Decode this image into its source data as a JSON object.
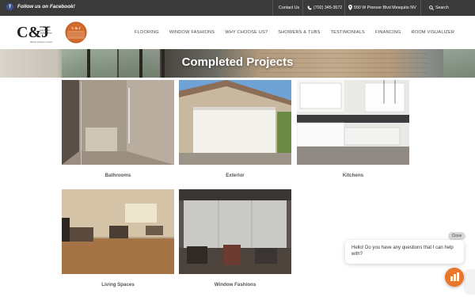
{
  "topbar": {
    "facebook_label": "Follow us on Facebook!",
    "contact_label": "Contact Us",
    "phone": "(702) 345-3672",
    "address": "550 W Pioneer Blvd Mesquite NV",
    "search_label": "Search"
  },
  "brand": {
    "logo_initials": "C&J",
    "owners_title": "OWNERS",
    "owner_1": "Cole Barton",
    "owner_2": "Jackie Barton",
    "tagline": "Home Design Center",
    "badge_text": "C & J"
  },
  "nav": {
    "items": [
      "FLOORING",
      "WINDOW FASHIONS",
      "WHY CHOOSE US?",
      "SHOWERS & TUBS",
      "TESTIMONIALS",
      "FINANCING",
      "ROOM VISUALIZER"
    ]
  },
  "hero": {
    "title": "Completed Projects"
  },
  "gallery": {
    "items": [
      {
        "caption": "Bathrooms"
      },
      {
        "caption": "Exterior"
      },
      {
        "caption": "Kitchens"
      },
      {
        "caption": "Living Spaces"
      },
      {
        "caption": "Window Fashions"
      }
    ]
  },
  "chat": {
    "close_label": "Close",
    "message": "Hello! Do you have any questions that I can help with?"
  },
  "colors": {
    "topbar_bg": "#3a3a3a",
    "accent_orange": "#e8762b",
    "facebook_blue": "#3b5998"
  }
}
